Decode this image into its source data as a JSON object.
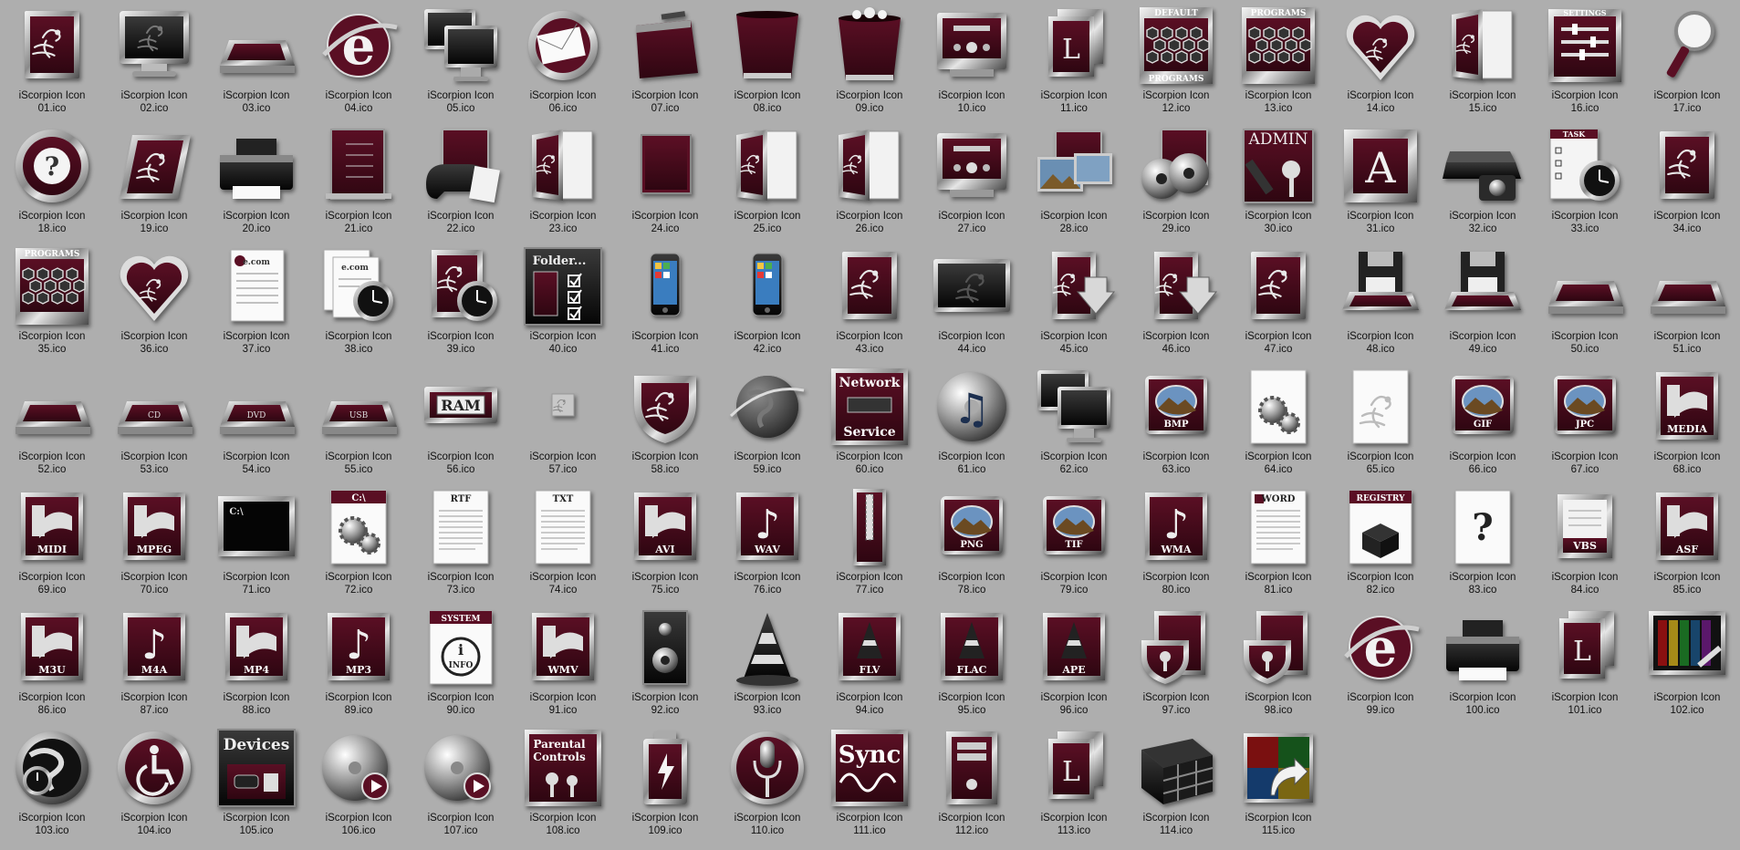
{
  "view": "icon-grid",
  "colors": {
    "background": "#aeaeae",
    "maroon": "#5a0f24",
    "maroon_dark": "#2e0611",
    "chrome": "#d8d8d8",
    "text": "#101010"
  },
  "caption_prefix": "iScorpion Icon",
  "files": [
    {
      "line1": "iScorpion Icon",
      "line2": "01.ico",
      "icon": "scorpion-frame-icon",
      "style": "frame",
      "label": ""
    },
    {
      "line1": "iScorpion Icon",
      "line2": "02.ico",
      "icon": "monitor-icon",
      "style": "monitor",
      "label": ""
    },
    {
      "line1": "iScorpion Icon",
      "line2": "03.ico",
      "icon": "drive-icon",
      "style": "drive",
      "label": ""
    },
    {
      "line1": "iScorpion Icon",
      "line2": "04.ico",
      "icon": "internet-explorer-icon",
      "style": "ie",
      "label": ""
    },
    {
      "line1": "iScorpion Icon",
      "line2": "05.ico",
      "icon": "network-computers-icon",
      "style": "monitor2",
      "label": ""
    },
    {
      "line1": "iScorpion Icon",
      "line2": "06.ico",
      "icon": "mail-icon",
      "style": "mail",
      "label": ""
    },
    {
      "line1": "iScorpion Icon",
      "line2": "07.ico",
      "icon": "box-icon",
      "style": "box",
      "label": ""
    },
    {
      "line1": "iScorpion Icon",
      "line2": "08.ico",
      "icon": "recycle-bin-empty-icon",
      "style": "bin",
      "label": ""
    },
    {
      "line1": "iScorpion Icon",
      "line2": "09.ico",
      "icon": "recycle-bin-full-icon",
      "style": "binfull",
      "label": ""
    },
    {
      "line1": "iScorpion Icon",
      "line2": "10.ico",
      "icon": "stereo-icon",
      "style": "stereo",
      "label": ""
    },
    {
      "line1": "iScorpion Icon",
      "line2": "11.ico",
      "icon": "fonts-folder-icon",
      "style": "folderL",
      "label": "L"
    },
    {
      "line1": "iScorpion Icon",
      "line2": "12.ico",
      "icon": "default-programs-icon",
      "style": "hexes",
      "label": "DEFAULT PROGRAMS"
    },
    {
      "line1": "iScorpion Icon",
      "line2": "13.ico",
      "icon": "programs-icon",
      "style": "hexes",
      "label": "PROGRAMS"
    },
    {
      "line1": "iScorpion Icon",
      "line2": "14.ico",
      "icon": "heart-icon",
      "style": "heart",
      "label": ""
    },
    {
      "line1": "iScorpion Icon",
      "line2": "15.ico",
      "icon": "folder-open-icon",
      "style": "folder",
      "label": ""
    },
    {
      "line1": "iScorpion Icon",
      "line2": "16.ico",
      "icon": "settings-icon",
      "style": "settings",
      "label": "SETTINGS"
    },
    {
      "line1": "iScorpion Icon",
      "line2": "17.ico",
      "icon": "magnifier-icon",
      "style": "magnifier",
      "label": ""
    },
    {
      "line1": "iScorpion Icon",
      "line2": "18.ico",
      "icon": "help-icon",
      "style": "help",
      "label": "?"
    },
    {
      "line1": "iScorpion Icon",
      "line2": "19.ico",
      "icon": "scorpion-tile-icon",
      "style": "tile",
      "label": ""
    },
    {
      "line1": "iScorpion Icon",
      "line2": "20.ico",
      "icon": "printer-icon",
      "style": "printer",
      "label": ""
    },
    {
      "line1": "iScorpion Icon",
      "line2": "21.ico",
      "icon": "document-list-icon",
      "style": "doclist",
      "label": ""
    },
    {
      "line1": "iScorpion Icon",
      "line2": "22.ico",
      "icon": "games-icon",
      "style": "games",
      "label": ""
    },
    {
      "line1": "iScorpion Icon",
      "line2": "23.ico",
      "icon": "folder-open-icon",
      "style": "folder",
      "label": ""
    },
    {
      "line1": "iScorpion Icon",
      "line2": "24.ico",
      "icon": "blank-tile-icon",
      "style": "blank",
      "label": ""
    },
    {
      "line1": "iScorpion Icon",
      "line2": "25.ico",
      "icon": "folder-side-icon",
      "style": "folder",
      "label": ""
    },
    {
      "line1": "iScorpion Icon",
      "line2": "26.ico",
      "icon": "documents-folder-icon",
      "style": "folder",
      "label": ""
    },
    {
      "line1": "iScorpion Icon",
      "line2": "27.ico",
      "icon": "music-stereo-icon",
      "style": "stereo",
      "label": ""
    },
    {
      "line1": "iScorpion Icon",
      "line2": "28.ico",
      "icon": "pictures-icon",
      "style": "pictures",
      "label": ""
    },
    {
      "line1": "iScorpion Icon",
      "line2": "29.ico",
      "icon": "video-reels-icon",
      "style": "reels",
      "label": ""
    },
    {
      "line1": "iScorpion Icon",
      "line2": "30.ico",
      "icon": "admin-key-icon",
      "style": "admin",
      "label": "ADMIN"
    },
    {
      "line1": "iScorpion Icon",
      "line2": "31.ico",
      "icon": "font-a-icon",
      "style": "letterA",
      "label": "A"
    },
    {
      "line1": "iScorpion Icon",
      "line2": "32.ico",
      "icon": "scanner-camera-icon",
      "style": "scanner",
      "label": ""
    },
    {
      "line1": "iScorpion Icon",
      "line2": "33.ico",
      "icon": "task-scheduler-icon",
      "style": "task",
      "label": "TASK"
    },
    {
      "line1": "iScorpion Icon",
      "line2": "34.ico",
      "icon": "script-c-icon",
      "style": "frame",
      "label": ""
    },
    {
      "line1": "iScorpion Icon",
      "line2": "35.ico",
      "icon": "programs-download-icon",
      "style": "hexes",
      "label": "PROGRAMS"
    },
    {
      "line1": "iScorpion Icon",
      "line2": "36.ico",
      "icon": "favorites-heart-icon",
      "style": "heart",
      "label": ""
    },
    {
      "line1": "iScorpion Icon",
      "line2": "37.ico",
      "icon": "web-document-icon",
      "style": "paper",
      "label": "e.com"
    },
    {
      "line1": "iScorpion Icon",
      "line2": "38.ico",
      "icon": "web-history-icon",
      "style": "paperclock",
      "label": "e.com"
    },
    {
      "line1": "iScorpion Icon",
      "line2": "39.ico",
      "icon": "clock-frame-icon",
      "style": "frameclock",
      "label": ""
    },
    {
      "line1": "iScorpion Icon",
      "line2": "40.ico",
      "icon": "folder-options-icon",
      "style": "folderopt",
      "label": "Folder..."
    },
    {
      "line1": "iScorpion Icon",
      "line2": "41.ico",
      "icon": "iphone-icon",
      "style": "phone",
      "label": ""
    },
    {
      "line1": "iScorpion Icon",
      "line2": "42.ico",
      "icon": "iphone-sync-icon",
      "style": "phone",
      "label": ""
    },
    {
      "line1": "iScorpion Icon",
      "line2": "43.ico",
      "icon": "edit-pen-icon",
      "style": "frame",
      "label": ""
    },
    {
      "line1": "iScorpion Icon",
      "line2": "44.ico",
      "icon": "desktop-icon",
      "style": "widescreen",
      "label": ""
    },
    {
      "line1": "iScorpion Icon",
      "line2": "45.ico",
      "icon": "download-arrow-icon",
      "style": "folderarrow",
      "label": ""
    },
    {
      "line1": "iScorpion Icon",
      "line2": "46.ico",
      "icon": "upload-arrow-icon",
      "style": "folderarrow",
      "label": ""
    },
    {
      "line1": "iScorpion Icon",
      "line2": "47.ico",
      "icon": "search-frame-icon",
      "style": "frame",
      "label": ""
    },
    {
      "line1": "iScorpion Icon",
      "line2": "48.ico",
      "icon": "floppy-drive-icon",
      "style": "floppy",
      "label": ""
    },
    {
      "line1": "iScorpion Icon",
      "line2": "49.ico",
      "icon": "floppy-drive-icon",
      "style": "floppy",
      "label": ""
    },
    {
      "line1": "iScorpion Icon",
      "line2": "50.ico",
      "icon": "drive-flat-icon",
      "style": "drive",
      "label": ""
    },
    {
      "line1": "iScorpion Icon",
      "line2": "51.ico",
      "icon": "drive-flat-icon",
      "style": "drive",
      "label": ""
    },
    {
      "line1": "iScorpion Icon",
      "line2": "52.ico",
      "icon": "hard-drive-icon",
      "style": "drive",
      "label": ""
    },
    {
      "line1": "iScorpion Icon",
      "line2": "53.ico",
      "icon": "cd-drive-icon",
      "style": "drive",
      "label": "CD"
    },
    {
      "line1": "iScorpion Icon",
      "line2": "54.ico",
      "icon": "dvd-drive-icon",
      "style": "drive",
      "label": "DVD"
    },
    {
      "line1": "iScorpion Icon",
      "line2": "55.ico",
      "icon": "usb-drive-icon",
      "style": "drive",
      "label": "USB"
    },
    {
      "line1": "iScorpion Icon",
      "line2": "56.ico",
      "icon": "ram-icon",
      "style": "ram",
      "label": "RAM"
    },
    {
      "line1": "iScorpion Icon",
      "line2": "57.ico",
      "icon": "tiny-scorpion-icon",
      "style": "tiny",
      "label": ""
    },
    {
      "line1": "iScorpion Icon",
      "line2": "58.ico",
      "icon": "shield-icon",
      "style": "shield",
      "label": ""
    },
    {
      "line1": "iScorpion Icon",
      "line2": "59.ico",
      "icon": "globe-icon",
      "style": "globe",
      "label": ""
    },
    {
      "line1": "iScorpion Icon",
      "line2": "60.ico",
      "icon": "network-service-icon",
      "style": "netservice",
      "label": "Network Service"
    },
    {
      "line1": "iScorpion Icon",
      "line2": "61.ico",
      "icon": "music-cd-icon",
      "style": "musiccd",
      "label": ""
    },
    {
      "line1": "iScorpion Icon",
      "line2": "62.ico",
      "icon": "computer-download-icon",
      "style": "monitor2",
      "label": ""
    },
    {
      "line1": "iScorpion Icon",
      "line2": "63.ico",
      "icon": "bmp-file-icon",
      "style": "imgfile",
      "label": "BMP"
    },
    {
      "line1": "iScorpion Icon",
      "line2": "64.ico",
      "icon": "gears-page-icon",
      "style": "gears",
      "label": ""
    },
    {
      "line1": "iScorpion Icon",
      "line2": "65.ico",
      "icon": "scorpion-page-icon",
      "style": "whitepage",
      "label": ""
    },
    {
      "line1": "iScorpion Icon",
      "line2": "66.ico",
      "icon": "gif-file-icon",
      "style": "imgfile",
      "label": "GIF"
    },
    {
      "line1": "iScorpion Icon",
      "line2": "67.ico",
      "icon": "jpc-file-icon",
      "style": "imgfile",
      "label": "JPC"
    },
    {
      "line1": "iScorpion Icon",
      "line2": "68.ico",
      "icon": "media-file-icon",
      "style": "media",
      "label": "MEDIA"
    },
    {
      "line1": "iScorpion Icon",
      "line2": "69.ico",
      "icon": "midi-file-icon",
      "style": "media",
      "label": "MIDI"
    },
    {
      "line1": "iScorpion Icon",
      "line2": "70.ico",
      "icon": "mpeg-file-icon",
      "style": "media",
      "label": "MPEG"
    },
    {
      "line1": "iScorpion Icon",
      "line2": "71.ico",
      "icon": "command-prompt-icon",
      "style": "cmd",
      "label": "C:\\"
    },
    {
      "line1": "iScorpion Icon",
      "line2": "72.ico",
      "icon": "config-gears-icon",
      "style": "gears",
      "label": "C:\\"
    },
    {
      "line1": "iScorpion Icon",
      "line2": "73.ico",
      "icon": "rtf-file-icon",
      "style": "textdoc",
      "label": "RTF"
    },
    {
      "line1": "iScorpion Icon",
      "line2": "74.ico",
      "icon": "txt-file-icon",
      "style": "textdoc",
      "label": "TXT"
    },
    {
      "line1": "iScorpion Icon",
      "line2": "75.ico",
      "icon": "avi-file-icon",
      "style": "media",
      "label": "AVI"
    },
    {
      "line1": "iScorpion Icon",
      "line2": "76.ico",
      "icon": "wav-file-icon",
      "style": "note",
      "label": "WAV"
    },
    {
      "line1": "iScorpion Icon",
      "line2": "77.ico",
      "icon": "zip-file-icon",
      "style": "zip",
      "label": ""
    },
    {
      "line1": "iScorpion Icon",
      "line2": "78.ico",
      "icon": "png-file-icon",
      "style": "imgfile",
      "label": "PNG"
    },
    {
      "line1": "iScorpion Icon",
      "line2": "79.ico",
      "icon": "tif-file-icon",
      "style": "imgfile",
      "label": "TIF"
    },
    {
      "line1": "iScorpion Icon",
      "line2": "80.ico",
      "icon": "wma-file-icon",
      "style": "note",
      "label": "WMA"
    },
    {
      "line1": "iScorpion Icon",
      "line2": "81.ico",
      "icon": "word-file-icon",
      "style": "textdoc",
      "label": "WORD"
    },
    {
      "line1": "iScorpion Icon",
      "line2": "82.ico",
      "icon": "registry-icon",
      "style": "registry",
      "label": "REGISTRY"
    },
    {
      "line1": "iScorpion Icon",
      "line2": "83.ico",
      "icon": "unknown-file-icon",
      "style": "unknown",
      "label": "?"
    },
    {
      "line1": "iScorpion Icon",
      "line2": "84.ico",
      "icon": "vbs-file-icon",
      "style": "scroll",
      "label": "VBS"
    },
    {
      "line1": "iScorpion Icon",
      "line2": "85.ico",
      "icon": "asf-file-icon",
      "style": "media",
      "label": "ASF"
    },
    {
      "line1": "iScorpion Icon",
      "line2": "86.ico",
      "icon": "m3u-file-icon",
      "style": "media",
      "label": "M3U"
    },
    {
      "line1": "iScorpion Icon",
      "line2": "87.ico",
      "icon": "m4a-file-icon",
      "style": "note",
      "label": "M4A"
    },
    {
      "line1": "iScorpion Icon",
      "line2": "88.ico",
      "icon": "mp4-file-icon",
      "style": "media",
      "label": "MP4"
    },
    {
      "line1": "iScorpion Icon",
      "line2": "89.ico",
      "icon": "mp3-file-icon",
      "style": "note",
      "label": "MP3"
    },
    {
      "line1": "iScorpion Icon",
      "line2": "90.ico",
      "icon": "system-info-icon",
      "style": "sysinfo",
      "label": "SYSTEM"
    },
    {
      "line1": "iScorpion Icon",
      "line2": "91.ico",
      "icon": "wmv-file-icon",
      "style": "media",
      "label": "WMV"
    },
    {
      "line1": "iScorpion Icon",
      "line2": "92.ico",
      "icon": "speaker-icon",
      "style": "speaker",
      "label": ""
    },
    {
      "line1": "iScorpion Icon",
      "line2": "93.ico",
      "icon": "vlc-cone-icon",
      "style": "cone",
      "label": ""
    },
    {
      "line1": "iScorpion Icon",
      "line2": "94.ico",
      "icon": "flv-file-icon",
      "style": "conefile",
      "label": "FLV"
    },
    {
      "line1": "iScorpion Icon",
      "line2": "95.ico",
      "icon": "flac-file-icon",
      "style": "conefile",
      "label": "FLAC"
    },
    {
      "line1": "iScorpion Icon",
      "line2": "96.ico",
      "icon": "ape-file-icon",
      "style": "conefile",
      "label": "APE"
    },
    {
      "line1": "iScorpion Icon",
      "line2": "97.ico",
      "icon": "security-shield-icon",
      "style": "keyshield",
      "label": ""
    },
    {
      "line1": "iScorpion Icon",
      "line2": "98.ico",
      "icon": "keyhole-shield-icon",
      "style": "keyshield",
      "label": ""
    },
    {
      "line1": "iScorpion Icon",
      "line2": "99.ico",
      "icon": "ie-drive-icon",
      "style": "ie",
      "label": ""
    },
    {
      "line1": "iScorpion Icon",
      "line2": "100.ico",
      "icon": "devices-printers-icon",
      "style": "printer",
      "label": ""
    },
    {
      "line1": "iScorpion Icon",
      "line2": "101.ico",
      "icon": "font-security-icon",
      "style": "folderL",
      "label": "L"
    },
    {
      "line1": "iScorpion Icon",
      "line2": "102.ico",
      "icon": "display-color-icon",
      "style": "colorbars",
      "label": ""
    },
    {
      "line1": "iScorpion Icon",
      "line2": "103.ico",
      "icon": "globe-clock-icon",
      "style": "globeclock",
      "label": ""
    },
    {
      "line1": "iScorpion Icon",
      "line2": "104.ico",
      "icon": "accessibility-icon",
      "style": "access",
      "label": ""
    },
    {
      "line1": "iScorpion Icon",
      "line2": "105.ico",
      "icon": "devices-icon",
      "style": "devices",
      "label": "Devices"
    },
    {
      "line1": "iScorpion Icon",
      "line2": "106.ico",
      "icon": "cd-play-icon",
      "style": "cdplay",
      "label": ""
    },
    {
      "line1": "iScorpion Icon",
      "line2": "107.ico",
      "icon": "cd-burn-icon",
      "style": "cdplay",
      "label": ""
    },
    {
      "line1": "iScorpion Icon",
      "line2": "108.ico",
      "icon": "parental-controls-icon",
      "style": "parental",
      "label": "Parental Controls"
    },
    {
      "line1": "iScorpion Icon",
      "line2": "109.ico",
      "icon": "battery-icon",
      "style": "battery",
      "label": ""
    },
    {
      "line1": "iScorpion Icon",
      "line2": "110.ico",
      "icon": "microphone-icon",
      "style": "mic",
      "label": ""
    },
    {
      "line1": "iScorpion Icon",
      "line2": "111.ico",
      "icon": "sync-icon",
      "style": "sync",
      "label": "Sync"
    },
    {
      "line1": "iScorpion Icon",
      "line2": "112.ico",
      "icon": "computer-tower-icon",
      "style": "tower",
      "label": ""
    },
    {
      "line1": "iScorpion Icon",
      "line2": "113.ico",
      "icon": "font-folder-icon",
      "style": "folderL",
      "label": "L"
    },
    {
      "line1": "iScorpion Icon",
      "line2": "114.ico",
      "icon": "firewall-icon",
      "style": "firewall",
      "label": ""
    },
    {
      "line1": "iScorpion Icon",
      "line2": "115.ico",
      "icon": "windows-update-icon",
      "style": "winupdate",
      "label": ""
    }
  ]
}
